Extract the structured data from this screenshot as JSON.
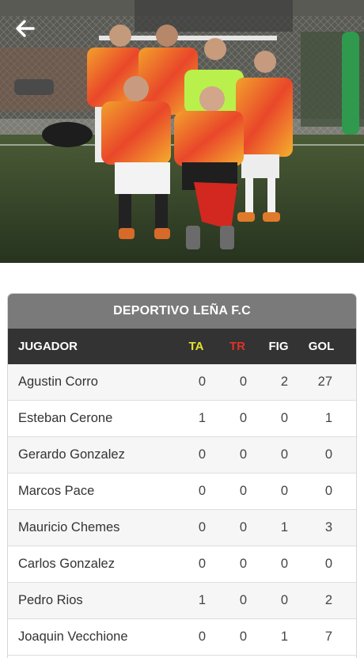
{
  "header": {
    "back_icon": "arrow-left-icon",
    "photo": "team-photo"
  },
  "team": {
    "name": "DEPORTIVO LEÑA F.C"
  },
  "table": {
    "columns": {
      "player": "JUGADOR",
      "ta": "TA",
      "tr": "TR",
      "fig": "FIG",
      "gol": "GOL"
    },
    "column_colors": {
      "ta": "#e3e22c",
      "tr": "#e0322a",
      "default": "#ffffff"
    },
    "rows": [
      {
        "name": "Agustin Corro",
        "ta": "0",
        "tr": "0",
        "fig": "2",
        "gol": "27"
      },
      {
        "name": "Esteban Cerone",
        "ta": "1",
        "tr": "0",
        "fig": "0",
        "gol": "1"
      },
      {
        "name": "Gerardo Gonzalez",
        "ta": "0",
        "tr": "0",
        "fig": "0",
        "gol": "0"
      },
      {
        "name": "Marcos Pace",
        "ta": "0",
        "tr": "0",
        "fig": "0",
        "gol": "0"
      },
      {
        "name": "Mauricio Chemes",
        "ta": "0",
        "tr": "0",
        "fig": "1",
        "gol": "3"
      },
      {
        "name": "Carlos Gonzalez",
        "ta": "0",
        "tr": "0",
        "fig": "0",
        "gol": "0"
      },
      {
        "name": "Pedro Rios",
        "ta": "1",
        "tr": "0",
        "fig": "0",
        "gol": "2"
      },
      {
        "name": "Joaquin Vecchione",
        "ta": "0",
        "tr": "0",
        "fig": "1",
        "gol": "7"
      }
    ]
  }
}
